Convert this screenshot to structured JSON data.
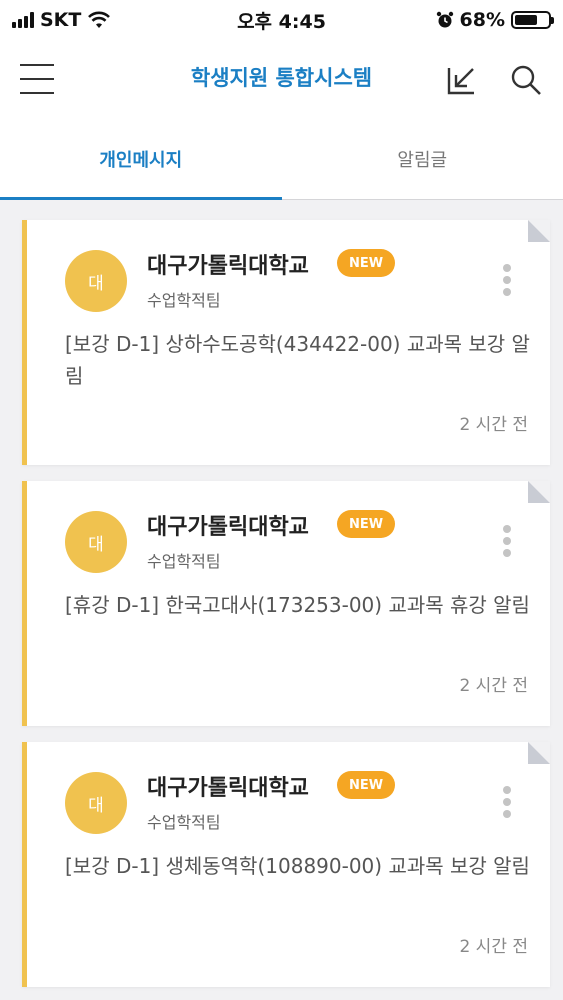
{
  "status": {
    "carrier": "SKT",
    "time": "오후 4:45",
    "battery": "68%",
    "battery_level": 0.68
  },
  "header": {
    "title": "학생지원 통합시스템"
  },
  "tabs": [
    {
      "label": "개인메시지",
      "active": true
    },
    {
      "label": "알림글",
      "active": false
    }
  ],
  "messages": [
    {
      "avatar": "대",
      "sender": "대구가톨릭대학교",
      "badge": "NEW",
      "dept": "수업학적팀",
      "body": "[보강 D-1] 상하수도공학(434422-00) 교과목 보강 알림",
      "time": "2 시간 전"
    },
    {
      "avatar": "대",
      "sender": "대구가톨릭대학교",
      "badge": "NEW",
      "dept": "수업학적팀",
      "body": "[휴강 D-1] 한국고대사(173253-00) 교과목 휴강 알림",
      "time": "2 시간 전"
    },
    {
      "avatar": "대",
      "sender": "대구가톨릭대학교",
      "badge": "NEW",
      "dept": "수업학적팀",
      "body": "[보강 D-1] 생체동역학(108890-00) 교과목 보강 알림",
      "time": "2 시간 전"
    }
  ],
  "colors": {
    "accent": "#1b7fc4",
    "card_bar": "#f0c24f",
    "badge": "#f5a623"
  }
}
